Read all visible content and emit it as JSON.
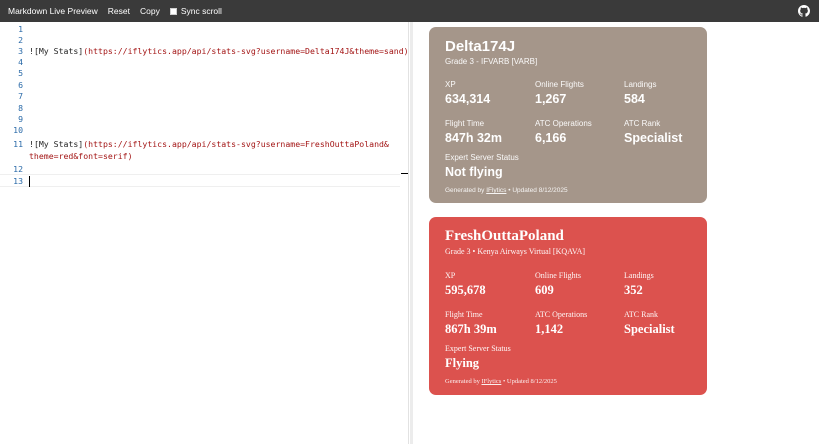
{
  "toolbar": {
    "title": "Markdown Live Preview",
    "reset": "Reset",
    "copy": "Copy",
    "sync_scroll": "Sync scroll"
  },
  "editor": {
    "lines": [
      {
        "num": "1",
        "bang": "",
        "alt": "",
        "url": ""
      },
      {
        "num": "2",
        "bang": "",
        "alt": "",
        "url": ""
      },
      {
        "num": "3",
        "bang": "!",
        "alt": "[My Stats]",
        "url": "(https://iflytics.app/api/stats-svg?username=Delta174J&theme=sand)"
      },
      {
        "num": "4",
        "bang": "",
        "alt": "",
        "url": ""
      },
      {
        "num": "5",
        "bang": "",
        "alt": "",
        "url": ""
      },
      {
        "num": "6",
        "bang": "",
        "alt": "",
        "url": ""
      },
      {
        "num": "7",
        "bang": "",
        "alt": "",
        "url": ""
      },
      {
        "num": "8",
        "bang": "",
        "alt": "",
        "url": ""
      },
      {
        "num": "9",
        "bang": "",
        "alt": "",
        "url": ""
      },
      {
        "num": "10",
        "bang": "",
        "alt": "",
        "url": ""
      },
      {
        "num": "11",
        "bang": "!",
        "alt": "[My Stats]",
        "url": "(https://iflytics.app/api/stats-svg?username=FreshOuttaPoland&"
      },
      {
        "num": "",
        "bang": "",
        "alt": "",
        "url": "theme=red&font=serif)"
      },
      {
        "num": "12",
        "bang": "",
        "alt": "",
        "url": ""
      },
      {
        "num": "13",
        "bang": "",
        "alt": "",
        "url": ""
      }
    ]
  },
  "cards": [
    {
      "name": "Delta174J",
      "subtitle": "Grade 3 - IFVARB [VARB]",
      "stats": [
        {
          "label": "XP",
          "value": "634,314"
        },
        {
          "label": "Online Flights",
          "value": "1,267"
        },
        {
          "label": "Landings",
          "value": "584"
        },
        {
          "label": "Flight Time",
          "value": "847h 32m"
        },
        {
          "label": "ATC Operations",
          "value": "6,166"
        },
        {
          "label": "ATC Rank",
          "value": "Specialist"
        },
        {
          "label": "Expert Server Status",
          "value": "Not flying"
        }
      ],
      "footer_prefix": "Generated by ",
      "footer_link": "IFlytics",
      "footer_suffix": " • Updated 8/12/2025",
      "color": "#a5968a"
    },
    {
      "name": "FreshOuttaPoland",
      "subtitle": "Grade 3 • Kenya Airways Virtual [KQAVA]",
      "stats": [
        {
          "label": "XP",
          "value": "595,678"
        },
        {
          "label": "Online Flights",
          "value": "609"
        },
        {
          "label": "Landings",
          "value": "352"
        },
        {
          "label": "Flight Time",
          "value": "867h 39m"
        },
        {
          "label": "ATC Operations",
          "value": "1,142"
        },
        {
          "label": "ATC Rank",
          "value": "Specialist"
        },
        {
          "label": "Expert Server Status",
          "value": "Flying"
        }
      ],
      "footer_prefix": "Generated by ",
      "footer_link": "IFlytics",
      "footer_suffix": " • Updated 8/12/2025",
      "color": "#dc524e"
    }
  ],
  "icons": {
    "github": "github-icon"
  }
}
